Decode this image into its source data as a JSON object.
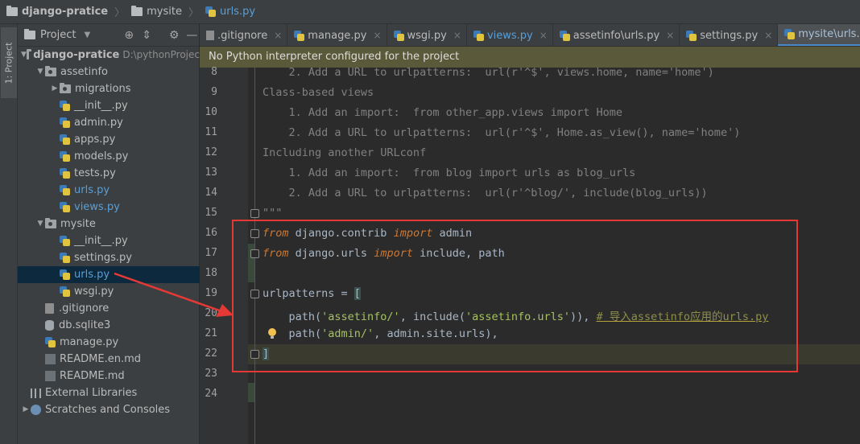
{
  "breadcrumbs": {
    "project": "django-pratice",
    "folder": "mysite",
    "file": "urls.py"
  },
  "side_strip": {
    "project_tab": "1: Project"
  },
  "project_panel": {
    "title": "Project",
    "tree": [
      {
        "label": "django-pratice",
        "hint": "D:\\pythonProjec",
        "kind": "folder",
        "depth": 0,
        "expanded": true
      },
      {
        "label": "assetinfo",
        "kind": "package",
        "depth": 1,
        "expanded": true
      },
      {
        "label": "migrations",
        "kind": "package",
        "depth": 2,
        "expanded": false
      },
      {
        "label": "__init__.py",
        "kind": "py",
        "depth": 2
      },
      {
        "label": "admin.py",
        "kind": "py",
        "depth": 2
      },
      {
        "label": "apps.py",
        "kind": "py",
        "depth": 2
      },
      {
        "label": "models.py",
        "kind": "py",
        "depth": 2
      },
      {
        "label": "tests.py",
        "kind": "py",
        "depth": 2
      },
      {
        "label": "urls.py",
        "kind": "py",
        "depth": 2,
        "modified": true
      },
      {
        "label": "views.py",
        "kind": "py",
        "depth": 2,
        "modified": true
      },
      {
        "label": "mysite",
        "kind": "package",
        "depth": 1,
        "expanded": true
      },
      {
        "label": "__init__.py",
        "kind": "py",
        "depth": 2
      },
      {
        "label": "settings.py",
        "kind": "py",
        "depth": 2
      },
      {
        "label": "urls.py",
        "kind": "py",
        "depth": 2,
        "modified": true,
        "selected": true
      },
      {
        "label": "wsgi.py",
        "kind": "py",
        "depth": 2
      },
      {
        "label": ".gitignore",
        "kind": "txt",
        "depth": 1
      },
      {
        "label": "db.sqlite3",
        "kind": "db",
        "depth": 1
      },
      {
        "label": "manage.py",
        "kind": "py",
        "depth": 1
      },
      {
        "label": "README.en.md",
        "kind": "md",
        "depth": 1
      },
      {
        "label": "README.md",
        "kind": "md",
        "depth": 1
      },
      {
        "label": "External Libraries",
        "kind": "lib",
        "depth": 0
      },
      {
        "label": "Scratches and Consoles",
        "kind": "scratch",
        "depth": 0,
        "expanded": false
      }
    ]
  },
  "tabs": [
    {
      "label": ".gitignore",
      "kind": "txt"
    },
    {
      "label": "manage.py",
      "kind": "py"
    },
    {
      "label": "wsgi.py",
      "kind": "py"
    },
    {
      "label": "views.py",
      "kind": "py",
      "modified": true
    },
    {
      "label": "assetinfo\\urls.py",
      "kind": "py"
    },
    {
      "label": "settings.py",
      "kind": "py"
    },
    {
      "label": "mysite\\urls.py",
      "kind": "py",
      "active": true
    }
  ],
  "banner": "No Python interpreter configured for the project",
  "code_lines": [
    {
      "n": "8",
      "tokens": [
        [
          "cmg",
          "    2. Add a URL to urlpatterns:  url(r'^$', views.home, name='home')"
        ]
      ]
    },
    {
      "n": "9",
      "tokens": [
        [
          "cmg",
          "Class-based views"
        ]
      ]
    },
    {
      "n": "10",
      "tokens": [
        [
          "cmg",
          "    1. Add an import:  from other_app.views import Home"
        ]
      ]
    },
    {
      "n": "11",
      "tokens": [
        [
          "cmg",
          "    2. Add a URL to urlpatterns:  url(r'^$', Home.as_view(), name='home')"
        ]
      ]
    },
    {
      "n": "12",
      "tokens": [
        [
          "cmg",
          "Including another URLconf"
        ]
      ]
    },
    {
      "n": "13",
      "tokens": [
        [
          "cmg",
          "    1. Add an import:  from blog import urls as blog_urls"
        ]
      ]
    },
    {
      "n": "14",
      "tokens": [
        [
          "cmg",
          "    2. Add a URL to urlpatterns:  url(r'^blog/', include(blog_urls))"
        ]
      ]
    },
    {
      "n": "15",
      "tokens": [
        [
          "cmg",
          "\"\"\""
        ]
      ]
    },
    {
      "n": "16",
      "tokens": [
        [
          "kw",
          "from"
        ],
        [
          "ident",
          " django.contrib "
        ],
        [
          "kw",
          "import"
        ],
        [
          "ident",
          " admin"
        ]
      ]
    },
    {
      "n": "17",
      "tokens": [
        [
          "kw",
          "from"
        ],
        [
          "ident",
          " django.urls "
        ],
        [
          "kw",
          "import"
        ],
        [
          "ident",
          " include, path"
        ]
      ]
    },
    {
      "n": "18",
      "tokens": []
    },
    {
      "n": "19",
      "tokens": [
        [
          "ident",
          "urlpatterns = "
        ],
        [
          "hlparen",
          "["
        ]
      ]
    },
    {
      "n": "20",
      "tokens": [
        [
          "ident",
          "    path("
        ],
        [
          "str",
          "'assetinfo/'"
        ],
        [
          "ident",
          ", include("
        ],
        [
          "str",
          "'assetinfo.urls'"
        ],
        [
          "ident",
          ")), "
        ],
        [
          "todo",
          "# 导入assetinfo应用的urls.py"
        ]
      ]
    },
    {
      "n": "21",
      "tokens": [
        [
          "ident",
          "    path("
        ],
        [
          "str",
          "'admin/'"
        ],
        [
          "ident",
          ", admin.site.urls),"
        ]
      ]
    },
    {
      "n": "22",
      "tokens": [
        [
          "hlparen",
          "]"
        ]
      ]
    },
    {
      "n": "23",
      "tokens": []
    },
    {
      "n": "24",
      "tokens": []
    }
  ]
}
